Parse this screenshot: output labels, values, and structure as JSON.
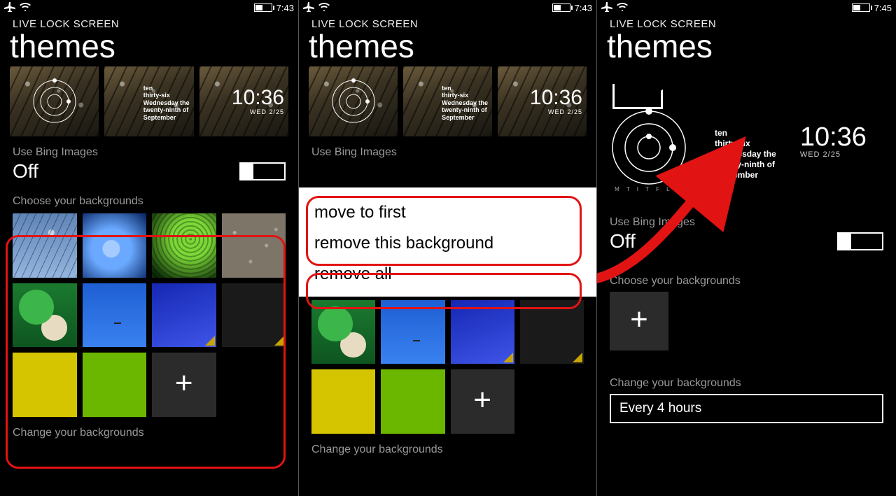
{
  "status": {
    "time_a": "7:43",
    "time_b": "7:43",
    "time_c": "7:45"
  },
  "app_title": "LIVE LOCK SCREEN",
  "page_title": "themes",
  "theme_preview": {
    "word_time": "ten\nthirty-six\nWednesday the\ntwenty-ninth of\nSeptember",
    "clock_time": "10:36",
    "clock_date": "WED 2/25"
  },
  "bing": {
    "label": "Use Bing Images",
    "value": "Off"
  },
  "choose_label": "Choose your backgrounds",
  "change_label": "Change your backgrounds",
  "interval_value": "Every 4 hours",
  "context_menu": {
    "move_first": "move to first",
    "remove_this": "remove this background",
    "remove_all": "remove all"
  },
  "dial_days": "M T I T F L S"
}
